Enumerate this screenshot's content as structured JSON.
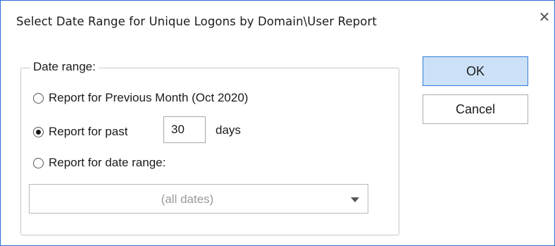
{
  "dialog": {
    "title": "Select Date Range for Unique Logons by Domain\\User Report",
    "close_glyph": "✕"
  },
  "date_range": {
    "legend": "Date range:",
    "options": [
      {
        "label": "Report for Previous Month (Oct 2020)",
        "checked": false
      },
      {
        "label": "Report for past",
        "checked": true
      },
      {
        "label": "Report for date range:",
        "checked": false
      }
    ],
    "days_value": "30",
    "days_suffix": "days",
    "range_select_value": "(all dates)"
  },
  "buttons": {
    "ok": "OK",
    "cancel": "Cancel"
  },
  "colors": {
    "window_border": "#2b6fd6",
    "ok_button_bg": "#cce1f7",
    "ok_button_border": "#2f7ad6"
  },
  "icons": {
    "close": "close-icon",
    "dropdown": "chevron-down-icon"
  }
}
